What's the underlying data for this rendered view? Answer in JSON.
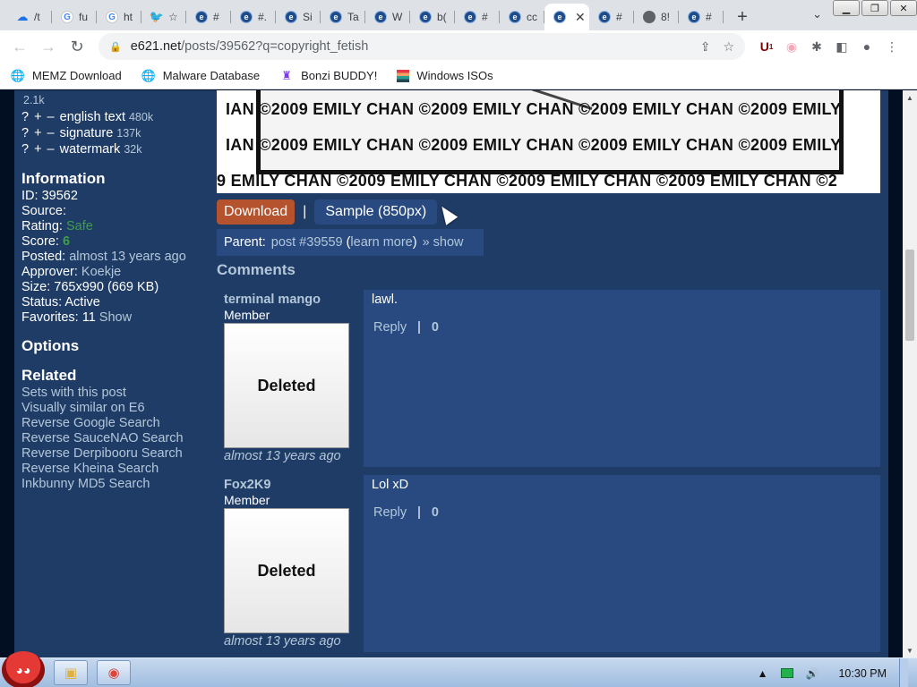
{
  "browser": {
    "tabs": [
      {
        "icon": "cloud-icon",
        "title": "/t"
      },
      {
        "icon": "google-icon",
        "title": "fu"
      },
      {
        "icon": "google-icon",
        "title": "ht"
      },
      {
        "icon": "twitter-icon",
        "title": "☆"
      },
      {
        "icon": "e621-icon",
        "title": "#"
      },
      {
        "icon": "e621-icon",
        "title": "#."
      },
      {
        "icon": "e621-icon",
        "title": "Si"
      },
      {
        "icon": "e621-icon",
        "title": "Ta"
      },
      {
        "icon": "e621-icon",
        "title": "W"
      },
      {
        "icon": "e621-icon",
        "title": "b("
      },
      {
        "icon": "e621-icon",
        "title": "#"
      },
      {
        "icon": "e621-icon",
        "title": "cc"
      },
      {
        "icon": "e621-icon",
        "title": "",
        "active": true
      },
      {
        "icon": "e621-icon",
        "title": "#"
      },
      {
        "icon": "globe-icon",
        "title": "8!"
      },
      {
        "icon": "e621-icon",
        "title": "#"
      }
    ],
    "url_domain": "e621.net",
    "url_path": "/posts/39562?q=copyright_fetish",
    "extension_badge": "1"
  },
  "bookmarks": [
    {
      "label": "MEMZ Download",
      "icon": "globe-icon"
    },
    {
      "label": "Malware Database",
      "icon": "globe-icon"
    },
    {
      "label": "Bonzi BUDDY!",
      "icon": "bonzi-icon"
    },
    {
      "label": "Windows ISOs",
      "icon": "windows-icon"
    }
  ],
  "sidebar": {
    "partial_count": "2.1k",
    "tags": [
      {
        "name": "english text",
        "count": "480k"
      },
      {
        "name": "signature",
        "count": "137k"
      },
      {
        "name": "watermark",
        "count": "32k"
      }
    ],
    "tag_controls": {
      "q": "?",
      "plus": "+",
      "minus": "–"
    },
    "information_heading": "Information",
    "info": {
      "id_label": "ID:",
      "id_value": "39562",
      "source_label": "Source:",
      "rating_label": "Rating:",
      "rating_value": "Safe",
      "score_label": "Score:",
      "score_value": "6",
      "posted_label": "Posted:",
      "posted_value": "almost 13 years ago",
      "approver_label": "Approver:",
      "approver_value": "Koekje",
      "size_label": "Size:",
      "size_value": "765x990 (669 KB)",
      "status_label": "Status:",
      "status_value": "Active",
      "favorites_label": "Favorites:",
      "favorites_value": "11",
      "favorites_show": "Show"
    },
    "options_heading": "Options",
    "related_heading": "Related",
    "related": [
      "Sets with this post",
      "Visually similar on E6",
      "Reverse Google Search",
      "Reverse SauceNAO Search",
      "Reverse Derpibooru Search",
      "Reverse Kheina Search",
      "Inkbunny MD5 Search"
    ]
  },
  "post": {
    "watermark_lines": [
      "IAN ©2009 EMILY CHAN ©2009 EMILY CHAN ©2009 EMILY CHAN ©2009 EMILY",
      "IAN ©2009 EMILY CHAN ©2009 EMILY CHAN ©2009 EMILY CHAN ©2009 EMILY",
      "9 EMILY CHAN ©2009 EMILY CHAN ©2009 EMILY CHAN ©2009 EMILY CHAN ©2"
    ],
    "download_label": "Download",
    "separator": "|",
    "sample_label": "Sample (850px)",
    "parent_label": "Parent:",
    "parent_link": "post #39559",
    "learn_more": "learn more",
    "show_link": "» show",
    "comments_heading": "Comments"
  },
  "comments": [
    {
      "user": "terminal mango",
      "level": "Member",
      "avatar_text": "Deleted",
      "time": "almost 13 years ago",
      "body": "lawl.",
      "reply": "Reply",
      "bar": "|",
      "score": "0"
    },
    {
      "user": "Fox2K9",
      "level": "Member",
      "avatar_text": "Deleted",
      "time": "almost 13 years ago",
      "body": "Lol xD",
      "reply": "Reply",
      "bar": "|",
      "score": "0"
    }
  ],
  "taskbar": {
    "clock": "10:30 PM"
  },
  "colors": {
    "page_bg": "#020f23",
    "section_bg": "#1f3c67",
    "box_bg": "#284a81",
    "link": "#b4c7d9",
    "download": "#b4532e",
    "safe": "#3e9e49"
  }
}
